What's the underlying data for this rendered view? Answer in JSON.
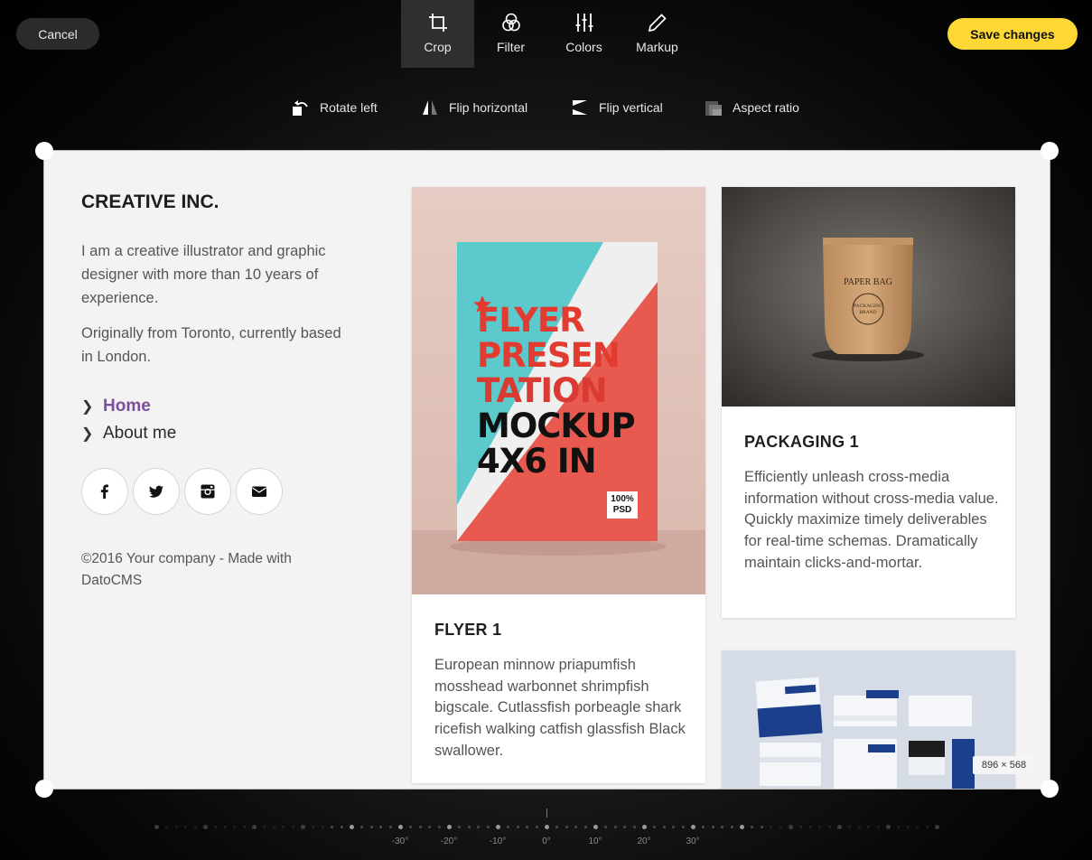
{
  "toolbar": {
    "cancel_label": "Cancel",
    "save_label": "Save changes",
    "tabs": [
      {
        "label": "Crop",
        "icon": "crop-icon",
        "active": true
      },
      {
        "label": "Filter",
        "icon": "filter-icon",
        "active": false
      },
      {
        "label": "Colors",
        "icon": "sliders-icon",
        "active": false
      },
      {
        "label": "Markup",
        "icon": "pencil-icon",
        "active": false
      }
    ]
  },
  "crop_tools": [
    {
      "label": "Rotate left",
      "icon": "rotate-left-icon"
    },
    {
      "label": "Flip horizontal",
      "icon": "flip-horizontal-icon"
    },
    {
      "label": "Flip vertical",
      "icon": "flip-vertical-icon"
    },
    {
      "label": "Aspect ratio",
      "icon": "aspect-ratio-icon"
    }
  ],
  "crop_size_label": "896 × 568",
  "accent_color": "#fdd835",
  "image": {
    "brand": "CREATIVE INC.",
    "bio_1": "I am a creative illustrator and graphic designer with more than 10 years of experience.",
    "bio_2": "Originally from Toronto, currently based in London.",
    "nav": [
      {
        "label": "Home",
        "active": true
      },
      {
        "label": "About me",
        "active": false
      }
    ],
    "social_icons": [
      "facebook-icon",
      "twitter-icon",
      "instagram-icon",
      "email-icon"
    ],
    "footer": "©2016 Your company - Made with DatoCMS",
    "flyer_poster": {
      "lines": [
        "FLYER",
        "PRESEN",
        "TATION",
        "MOCKUP",
        "4X6 IN"
      ],
      "badge_top": "100%",
      "badge_bottom": "PSD"
    },
    "paper_bag": {
      "title": "PAPER BAG",
      "brand": "PACKAGING BRAND"
    },
    "cards": [
      {
        "title": "FLYER 1",
        "text": "European minnow priapumfish mosshead warbonnet shrimpfish bigscale. Cutlassfish porbeagle shark ricefish walking catfish glassfish Black swallower."
      },
      {
        "title": "PACKAGING 1",
        "text": "Efficiently unleash cross-media information without cross-media value. Quickly maximize timely deliverables for real-time schemas. Dramatically maintain clicks-and-mortar."
      }
    ]
  },
  "rotation_ruler": {
    "labels": [
      "-30°",
      "-20°",
      "-10°",
      "0°",
      "10°",
      "20°",
      "30°"
    ],
    "value_degrees": 0
  }
}
